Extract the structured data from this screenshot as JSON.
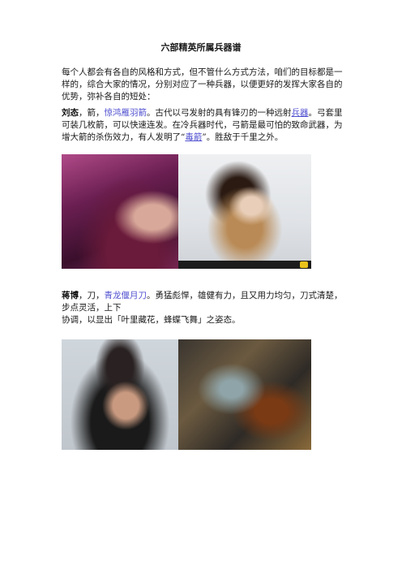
{
  "doc": {
    "title": "六部精英所属兵器谱",
    "intro": "每个人都会有各自的风格和方式，但不管什么方式方法，咱们的目标都是一样的，综合大家的情况，分别对应了一种兵器，以便更好的发挥大家各自的优势，弥补各自的短处：",
    "liu": {
      "name": "刘态",
      "sep": "，箭，",
      "weapon": "惊鸿雁羽箭",
      "text1": "。古代以弓发射的具有锋刃的一种远射",
      "link1": "兵器",
      "text2": "。弓套里可装几枚箭，可以快速连发。在冷兵器时代，弓箭是最可怕的致命武器，为增大箭的杀伤效力，有人发明了“",
      "link2": "毒箭",
      "text3": "”。胜敌于千里之外。"
    },
    "jiang": {
      "name": "蒋博",
      "sep": "，刀，",
      "weapon": "青龙偃月刀",
      "text1": "。勇猛彪悍，雄健有力，且又用力均匀，刀式清楚，步点灵活，上下",
      "text2": "协调，以显出「叶里藏花，蜂蝶飞舞」之姿态。"
    }
  }
}
